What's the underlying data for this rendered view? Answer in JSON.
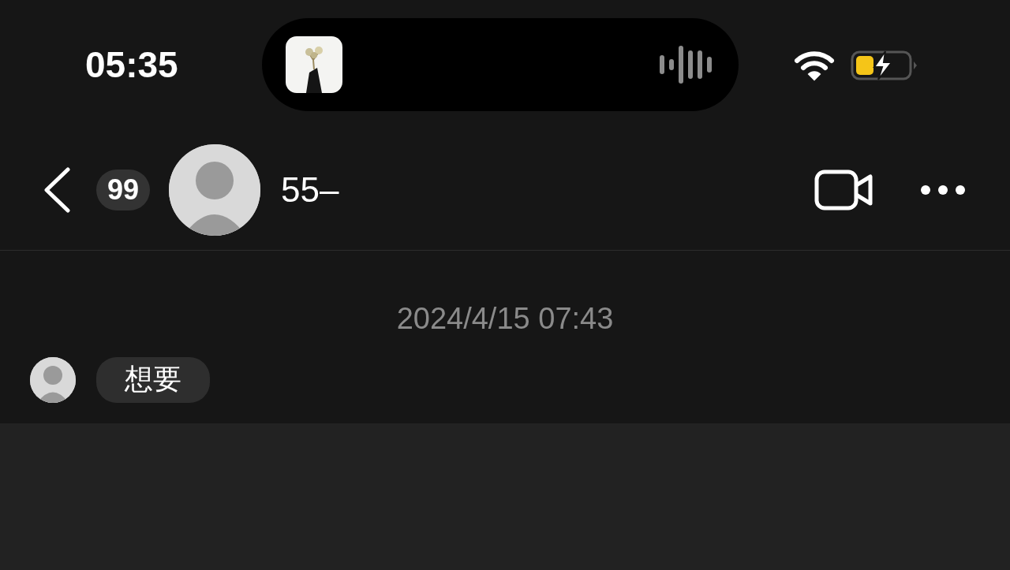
{
  "status_bar": {
    "time": "05:35"
  },
  "header": {
    "unread_count": "99",
    "contact_name": "55–"
  },
  "chat": {
    "timestamp": "2024/4/15 07:43",
    "messages": [
      {
        "text": "想要"
      }
    ]
  }
}
